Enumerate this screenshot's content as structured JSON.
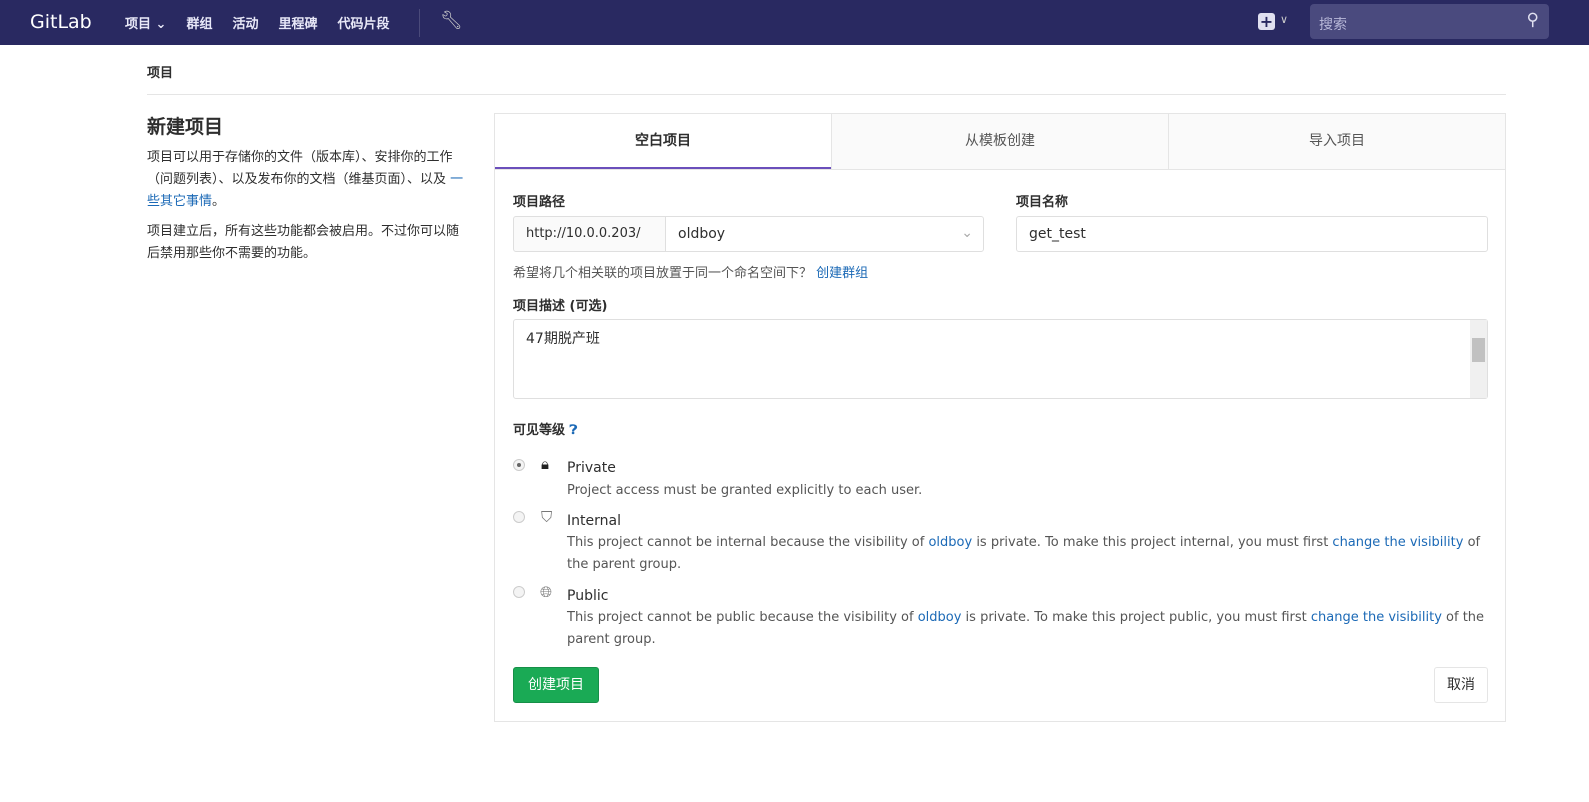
{
  "nav": {
    "brand": "GitLab",
    "links": [
      "项目",
      "群组",
      "活动",
      "里程碑",
      "代码片段"
    ],
    "search_placeholder": "搜索"
  },
  "breadcrumb": "项目",
  "intro": {
    "title": "新建项目",
    "p1": "项目可以用于存储你的文件（版本库）、安排你的工作（问题列表）、以及发布你的文档（维基页面）、以及 ",
    "p1_link": "一些其它事情",
    "p1_end": "。",
    "p2": "项目建立后，所有这些功能都会被启用。不过你可以随后禁用那些你不需要的功能。"
  },
  "tabs": [
    "空白项目",
    "从模板创建",
    "导入项目"
  ],
  "form": {
    "path_label": "项目路径",
    "path_prefix": "http://10.0.0.203/",
    "namespace": "oldboy",
    "name_label": "项目名称",
    "name_value": "get_test",
    "group_hint": "希望将几个相关联的项目放置于同一个命名空间下？ ",
    "group_link": "创建群组",
    "desc_label": "项目描述 (可选)",
    "desc_value": "47期脱产班",
    "visibility_label": "可见等级"
  },
  "visibility": [
    {
      "title": "Private",
      "icon": "lock-icon",
      "checked": true,
      "desc": [
        "Project access must be granted explicitly to each user."
      ]
    },
    {
      "title": "Internal",
      "icon": "shield-icon",
      "checked": false,
      "desc": [
        "This project cannot be internal because the visibility of ",
        "oldboy",
        " is private. To make this project internal, you must first ",
        "change the visibility",
        " of the parent group."
      ]
    },
    {
      "title": "Public",
      "icon": "globe-icon",
      "checked": false,
      "desc": [
        "This project cannot be public because the visibility of ",
        "oldboy",
        " is private. To make this project public, you must first ",
        "change the visibility",
        " of the parent group."
      ]
    }
  ],
  "buttons": {
    "create": "创建项目",
    "cancel": "取消"
  },
  "colors": {
    "nav": "#292961",
    "accent": "#6b4fbb",
    "create": "#1aaa55",
    "link": "#1b69b6"
  }
}
